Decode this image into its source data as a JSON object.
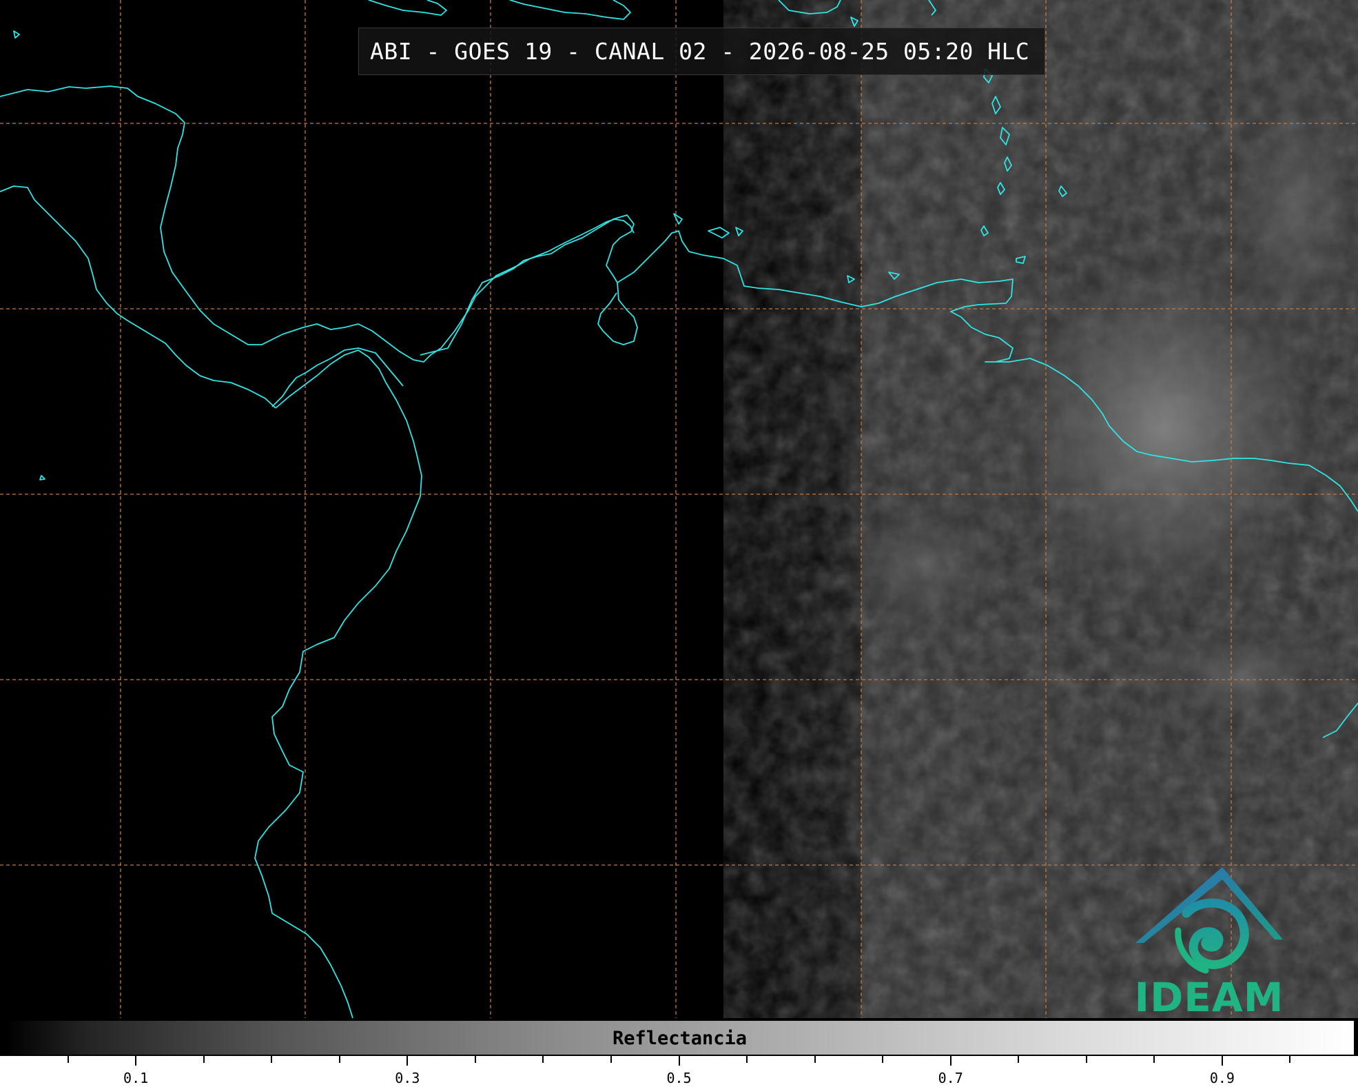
{
  "title": "ABI - GOES 19 - CANAL 02 - 2026-08-25 05:20 HLC",
  "logo": {
    "name": "ideam-logo",
    "text": "IDEAM"
  },
  "colorbar": {
    "label": "Reflectancia",
    "range": [
      0.0,
      1.0
    ],
    "major_ticks": [
      "0.1",
      "0.3",
      "0.5",
      "0.7",
      "0.9"
    ],
    "minor_step": 0.05
  },
  "colors": {
    "coastline": "#2ee6e6",
    "grid": "#c8783a",
    "logo_blue": "#2d6fb6",
    "logo_green": "#20b383"
  }
}
